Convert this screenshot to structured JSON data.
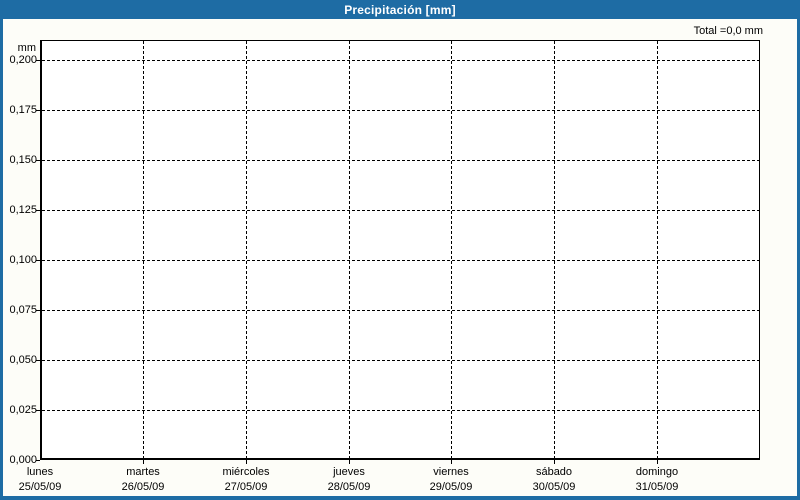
{
  "window": {
    "title": "Precipitación [mm]"
  },
  "chart_data": {
    "type": "bar",
    "title": "Precipitación [mm]",
    "unit_label": "mm",
    "total_label": "Total =0,0 mm",
    "total_value_mm": 0.0,
    "ylabel": "mm",
    "ylim": [
      0,
      0.21
    ],
    "grid": "dashed",
    "legend": "none",
    "y_ticks": [
      {
        "label": "0,200",
        "value": 0.2
      },
      {
        "label": "0,175",
        "value": 0.175
      },
      {
        "label": "0,150",
        "value": 0.15
      },
      {
        "label": "0,125",
        "value": 0.125
      },
      {
        "label": "0,100",
        "value": 0.1
      },
      {
        "label": "0,075",
        "value": 0.075
      },
      {
        "label": "0,050",
        "value": 0.05
      },
      {
        "label": "0,025",
        "value": 0.025
      },
      {
        "label": "0,000",
        "value": 0.0
      }
    ],
    "categories": [
      {
        "day": "lunes",
        "date": "25/05/09"
      },
      {
        "day": "martes",
        "date": "26/05/09"
      },
      {
        "day": "miércoles",
        "date": "27/05/09"
      },
      {
        "day": "jueves",
        "date": "28/05/09"
      },
      {
        "day": "viernes",
        "date": "29/05/09"
      },
      {
        "day": "sábado",
        "date": "30/05/09"
      },
      {
        "day": "domingo",
        "date": "31/05/09"
      }
    ],
    "series": [
      {
        "name": "Precipitación",
        "values": [
          0,
          0,
          0,
          0,
          0,
          0,
          0
        ]
      }
    ]
  },
  "colors": {
    "titlebar": "#1e6ca4",
    "frame": "#1e6ca4",
    "background": "#fdfdf8",
    "plot_background": "#ffffff",
    "grid": "#000000",
    "text": "#000000",
    "title_text": "#ffffff"
  }
}
